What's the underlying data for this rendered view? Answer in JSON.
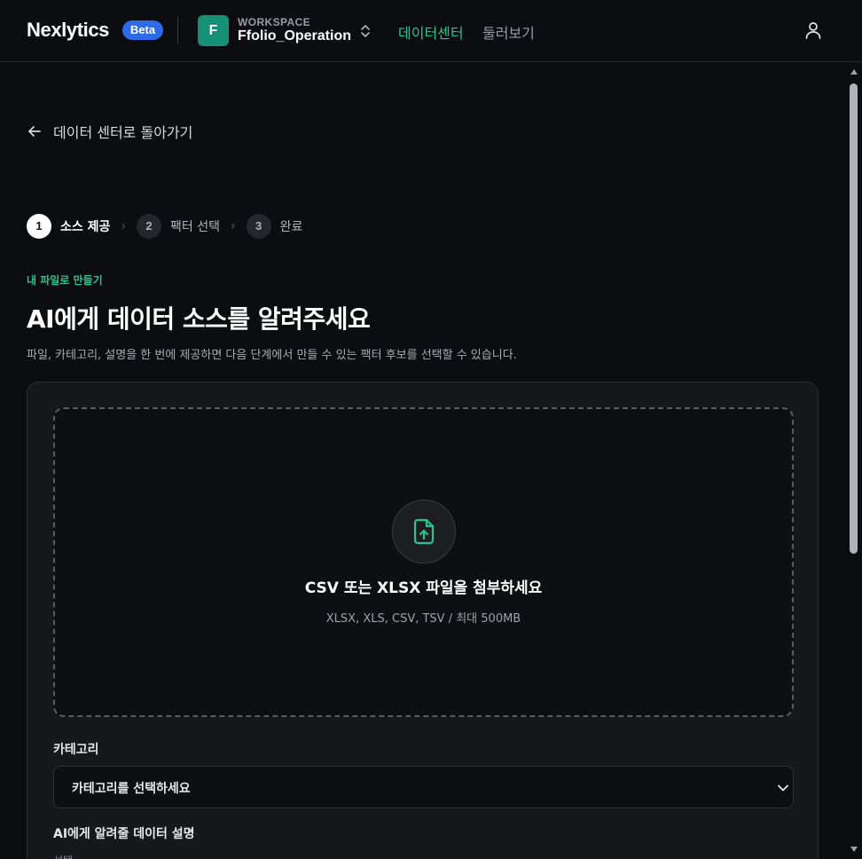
{
  "header": {
    "brand": "Nexlytics",
    "badge": "Beta",
    "workspace": {
      "avatar_letter": "F",
      "label": "WORKSPACE",
      "name": "Ffolio_Operation"
    },
    "nav": [
      {
        "label": "데이터센터",
        "active": true
      },
      {
        "label": "둘러보기",
        "active": false
      }
    ],
    "icons": {
      "switcher": "chevron-up-down-icon",
      "user": "user-icon"
    }
  },
  "back_link": {
    "label": "데이터 센터로 돌아가기",
    "icon": "arrow-left-icon"
  },
  "stepper": [
    {
      "num": "1",
      "label": "소스 제공",
      "active": true
    },
    {
      "num": "2",
      "label": "팩터 선택",
      "active": false
    },
    {
      "num": "3",
      "label": "완료",
      "active": false
    }
  ],
  "stepper_separator": "›",
  "page": {
    "eyebrow": "내 파일로 만들기",
    "title": "AI에게 데이터 소스를 알려주세요",
    "description": "파일, 카테고리, 설명을 한 번에 제공하면 다음 단계에서 만들 수 있는 팩터 후보를 선택할 수 있습니다."
  },
  "upload": {
    "icon": "file-upload-icon",
    "title": "CSV 또는 XLSX 파일을 첨부하세요",
    "hint": "XLSX, XLS, CSV, TSV / 최대 500MB"
  },
  "category": {
    "label": "카테고리",
    "placeholder": "카테고리를 선택하세요"
  },
  "description_field": {
    "label": "AI에게 알려줄 데이터 설명",
    "sublabel": "선택"
  },
  "colors": {
    "accent_green": "#27c48c",
    "beta_blue": "#2f6ae6",
    "workspace_teal": "#169176",
    "background": "#0c0d10"
  }
}
